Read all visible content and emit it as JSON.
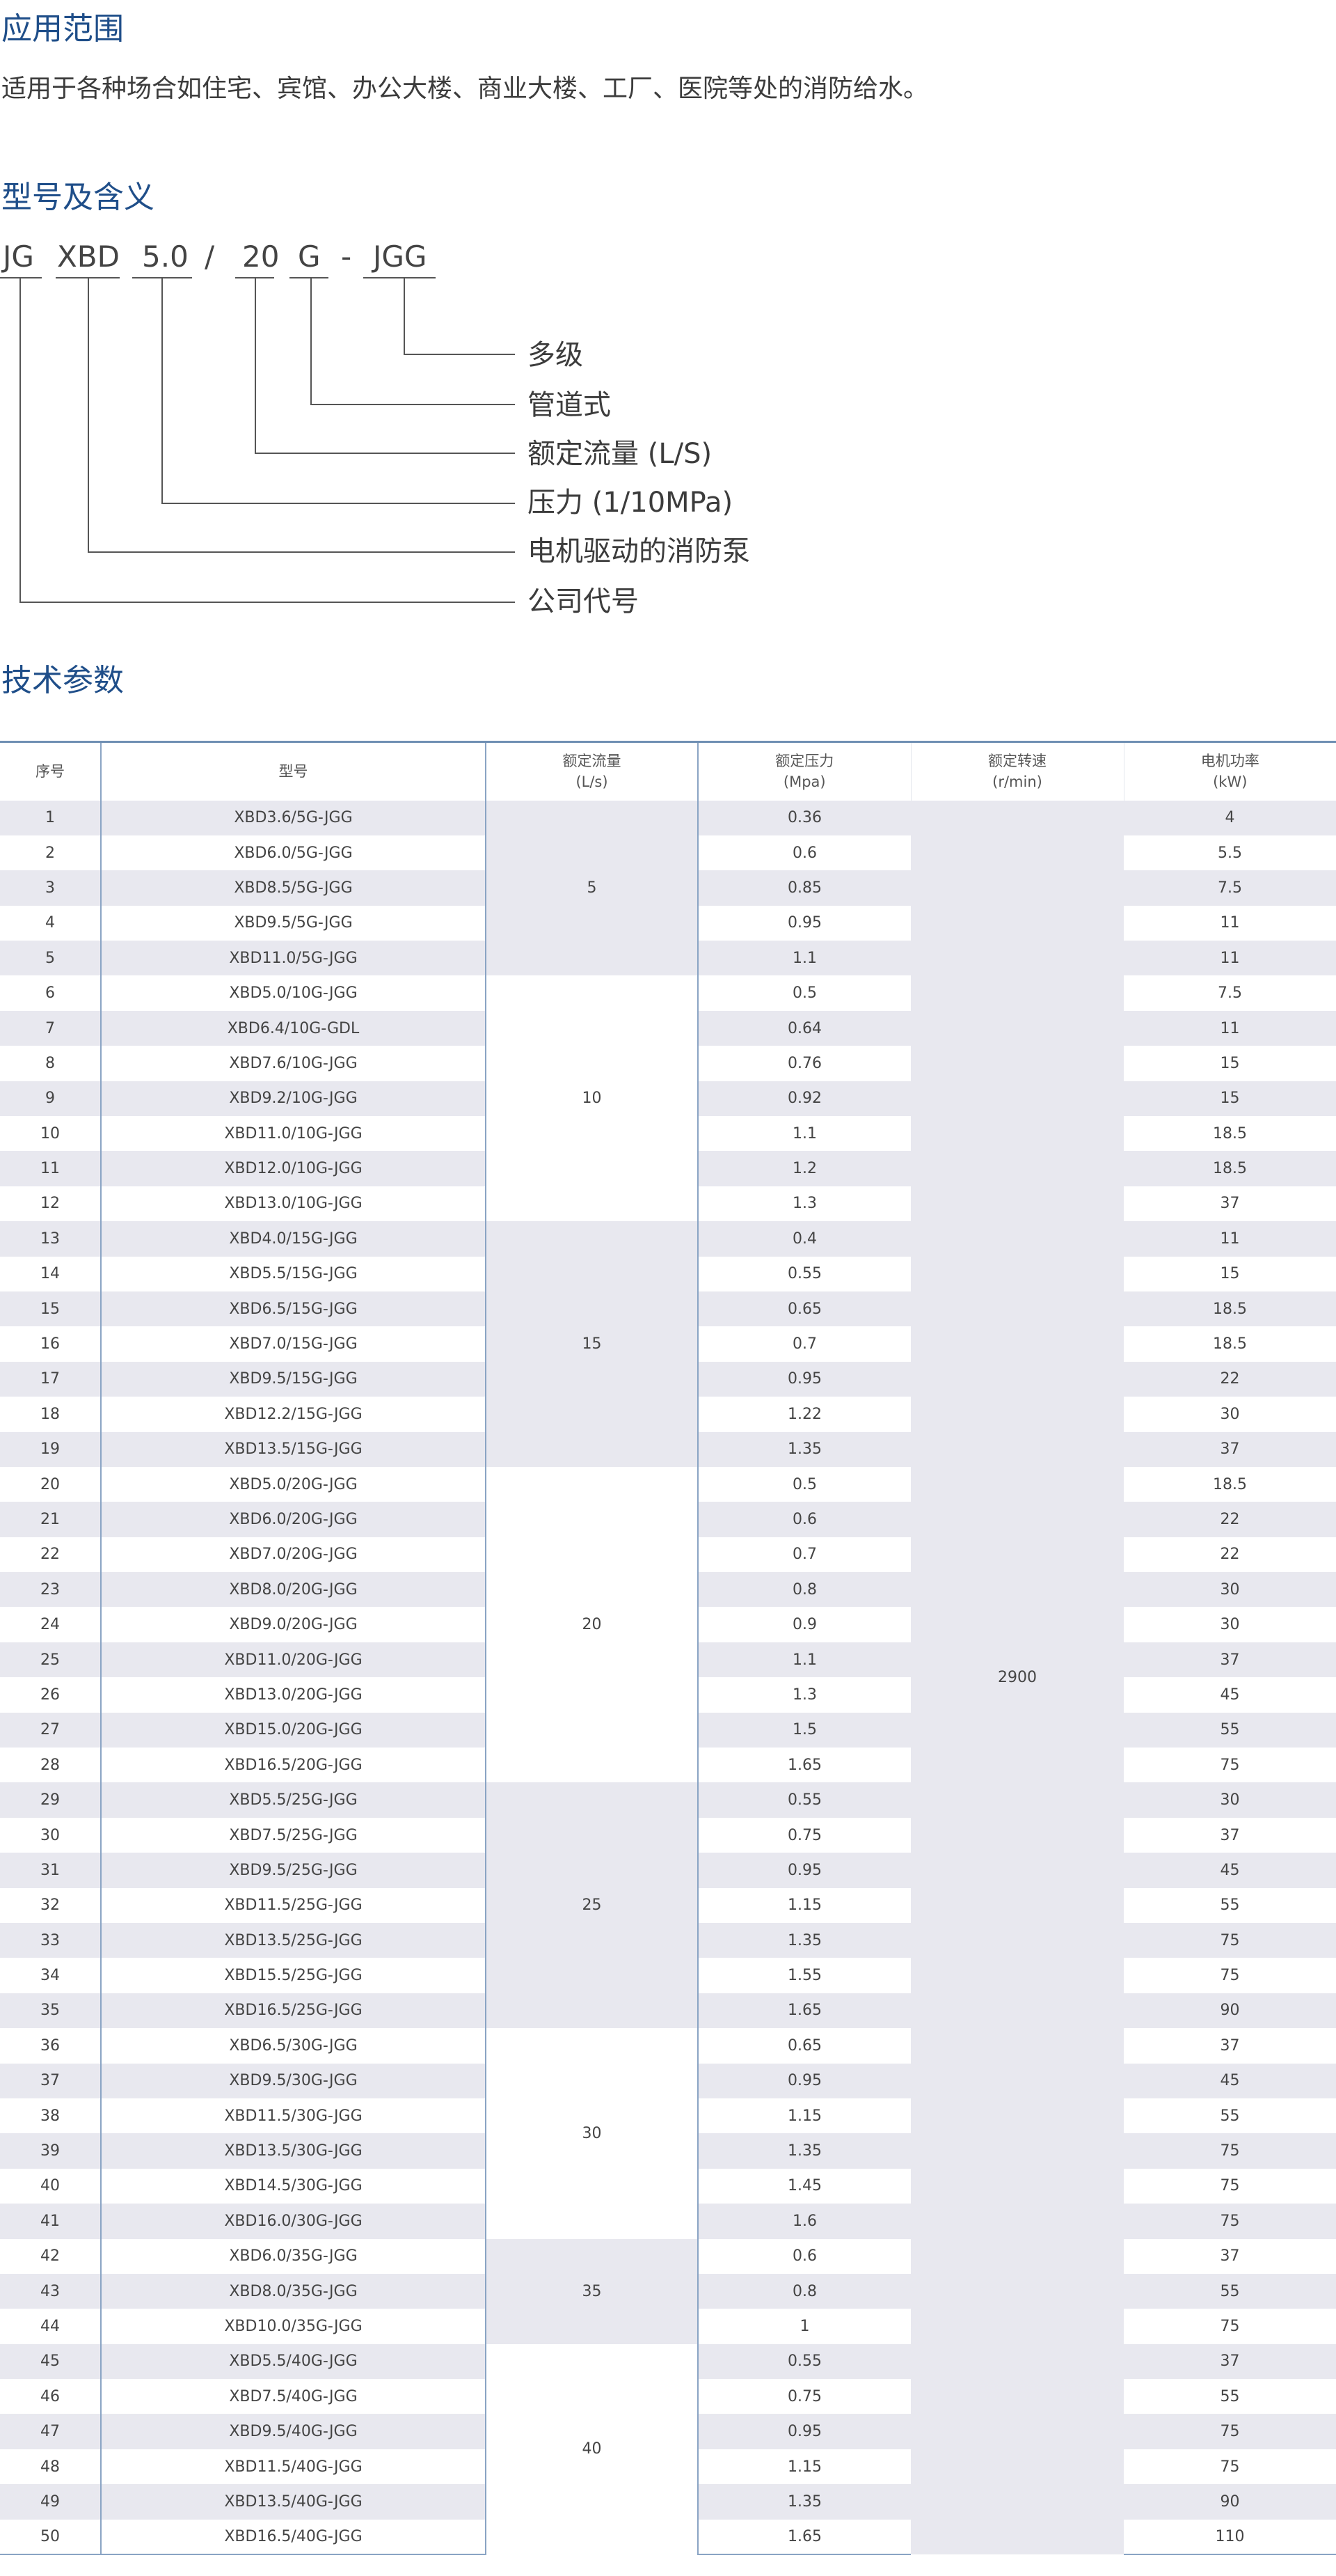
{
  "sections": {
    "application_title": "应用范围",
    "application_text": "适用于各种场合如住宅、宾馆、办公大楼、商业大楼、工厂、医院等处的消防给水。",
    "model_title": "型号及含义",
    "tech_title": "技术参数"
  },
  "model_code": {
    "parts": [
      "JG",
      "XBD",
      "5.0",
      "/",
      "20",
      "G",
      "-",
      "JGG"
    ],
    "meanings": [
      "多级",
      "管道式",
      "额定流量 (L/S)",
      "压力 (1/10MPa)",
      "电机驱动的消防泵",
      "公司代号"
    ]
  },
  "table": {
    "headers": {
      "index": "序号",
      "model": "型号",
      "flow": "额定流量",
      "flow_unit": "(L/s)",
      "pressure": "额定压力",
      "pressure_unit": "(Mpa)",
      "speed": "额定转速",
      "speed_unit": "(r/min)",
      "power": "电机功率",
      "power_unit": "(kW)"
    },
    "speed_value": "2900",
    "flow_groups": [
      {
        "value": "5",
        "rows": 5
      },
      {
        "value": "10",
        "rows": 7
      },
      {
        "value": "15",
        "rows": 7
      },
      {
        "value": "20",
        "rows": 9
      },
      {
        "value": "25",
        "rows": 7
      },
      {
        "value": "30",
        "rows": 6
      },
      {
        "value": "35",
        "rows": 3
      },
      {
        "value": "40",
        "rows": 6
      }
    ],
    "rows": [
      [
        "1",
        "XBD3.6/5G-JGG",
        "0.36",
        "4"
      ],
      [
        "2",
        "XBD6.0/5G-JGG",
        "0.6",
        "5.5"
      ],
      [
        "3",
        "XBD8.5/5G-JGG",
        "0.85",
        "7.5"
      ],
      [
        "4",
        "XBD9.5/5G-JGG",
        "0.95",
        "11"
      ],
      [
        "5",
        "XBD11.0/5G-JGG",
        "1.1",
        "11"
      ],
      [
        "6",
        "XBD5.0/10G-JGG",
        "0.5",
        "7.5"
      ],
      [
        "7",
        "XBD6.4/10G-GDL",
        "0.64",
        "11"
      ],
      [
        "8",
        "XBD7.6/10G-JGG",
        "0.76",
        "15"
      ],
      [
        "9",
        "XBD9.2/10G-JGG",
        "0.92",
        "15"
      ],
      [
        "10",
        "XBD11.0/10G-JGG",
        "1.1",
        "18.5"
      ],
      [
        "11",
        "XBD12.0/10G-JGG",
        "1.2",
        "18.5"
      ],
      [
        "12",
        "XBD13.0/10G-JGG",
        "1.3",
        "37"
      ],
      [
        "13",
        "XBD4.0/15G-JGG",
        "0.4",
        "11"
      ],
      [
        "14",
        "XBD5.5/15G-JGG",
        "0.55",
        "15"
      ],
      [
        "15",
        "XBD6.5/15G-JGG",
        "0.65",
        "18.5"
      ],
      [
        "16",
        "XBD7.0/15G-JGG",
        "0.7",
        "18.5"
      ],
      [
        "17",
        "XBD9.5/15G-JGG",
        "0.95",
        "22"
      ],
      [
        "18",
        "XBD12.2/15G-JGG",
        "1.22",
        "30"
      ],
      [
        "19",
        "XBD13.5/15G-JGG",
        "1.35",
        "37"
      ],
      [
        "20",
        "XBD5.0/20G-JGG",
        "0.5",
        "18.5"
      ],
      [
        "21",
        "XBD6.0/20G-JGG",
        "0.6",
        "22"
      ],
      [
        "22",
        "XBD7.0/20G-JGG",
        "0.7",
        "22"
      ],
      [
        "23",
        "XBD8.0/20G-JGG",
        "0.8",
        "30"
      ],
      [
        "24",
        "XBD9.0/20G-JGG",
        "0.9",
        "30"
      ],
      [
        "25",
        "XBD11.0/20G-JGG",
        "1.1",
        "37"
      ],
      [
        "26",
        "XBD13.0/20G-JGG",
        "1.3",
        "45"
      ],
      [
        "27",
        "XBD15.0/20G-JGG",
        "1.5",
        "55"
      ],
      [
        "28",
        "XBD16.5/20G-JGG",
        "1.65",
        "75"
      ],
      [
        "29",
        "XBD5.5/25G-JGG",
        "0.55",
        "30"
      ],
      [
        "30",
        "XBD7.5/25G-JGG",
        "0.75",
        "37"
      ],
      [
        "31",
        "XBD9.5/25G-JGG",
        "0.95",
        "45"
      ],
      [
        "32",
        "XBD11.5/25G-JGG",
        "1.15",
        "55"
      ],
      [
        "33",
        "XBD13.5/25G-JGG",
        "1.35",
        "75"
      ],
      [
        "34",
        "XBD15.5/25G-JGG",
        "1.55",
        "75"
      ],
      [
        "35",
        "XBD16.5/25G-JGG",
        "1.65",
        "90"
      ],
      [
        "36",
        "XBD6.5/30G-JGG",
        "0.65",
        "37"
      ],
      [
        "37",
        "XBD9.5/30G-JGG",
        "0.95",
        "45"
      ],
      [
        "38",
        "XBD11.5/30G-JGG",
        "1.15",
        "55"
      ],
      [
        "39",
        "XBD13.5/30G-JGG",
        "1.35",
        "75"
      ],
      [
        "40",
        "XBD14.5/30G-JGG",
        "1.45",
        "75"
      ],
      [
        "41",
        "XBD16.0/30G-JGG",
        "1.6",
        "75"
      ],
      [
        "42",
        "XBD6.0/35G-JGG",
        "0.6",
        "37"
      ],
      [
        "43",
        "XBD8.0/35G-JGG",
        "0.8",
        "55"
      ],
      [
        "44",
        "XBD10.0/35G-JGG",
        "1",
        "75"
      ],
      [
        "45",
        "XBD5.5/40G-JGG",
        "0.55",
        "37"
      ],
      [
        "46",
        "XBD7.5/40G-JGG",
        "0.75",
        "55"
      ],
      [
        "47",
        "XBD9.5/40G-JGG",
        "0.95",
        "75"
      ],
      [
        "48",
        "XBD11.5/40G-JGG",
        "1.15",
        "75"
      ],
      [
        "49",
        "XBD13.5/40G-JGG",
        "1.35",
        "90"
      ],
      [
        "50",
        "XBD16.5/40G-JGG",
        "1.65",
        "110"
      ]
    ]
  }
}
